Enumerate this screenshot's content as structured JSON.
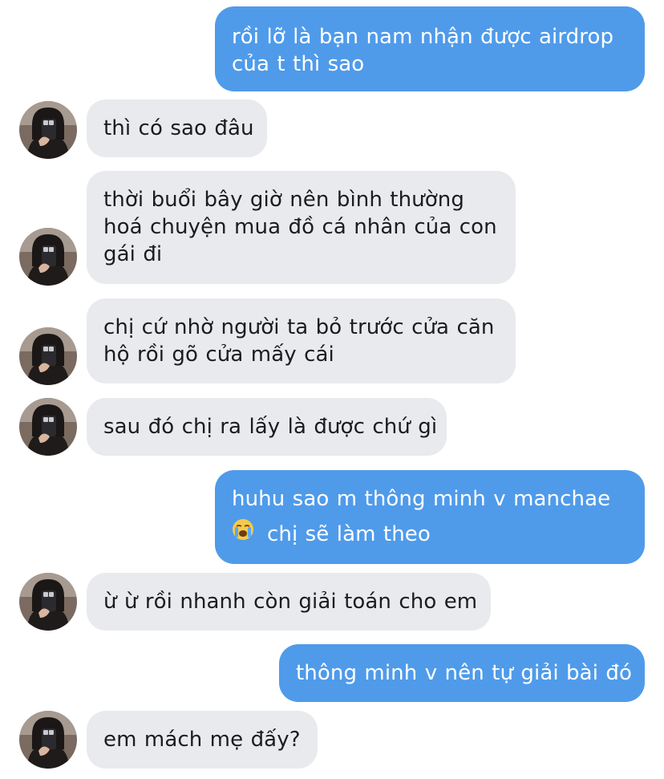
{
  "conversation": {
    "messages": [
      {
        "direction": "outgoing",
        "lines": [
          "rồi lỡ là bạn nam nhận được airdrop",
          "của t thì sao"
        ]
      },
      {
        "direction": "incoming",
        "lines": [
          "thì có sao đâu"
        ]
      },
      {
        "direction": "incoming",
        "lines": [
          "thời buổi bây giờ nên bình thường",
          "hoá chuyện mua đồ cá nhân của con",
          "gái đi"
        ]
      },
      {
        "direction": "incoming",
        "lines": [
          "chị cứ nhờ người ta bỏ trước cửa căn",
          "hộ rồi gõ cửa mấy cái"
        ]
      },
      {
        "direction": "incoming",
        "lines": [
          "sau đó chị ra lấy là được chứ gì"
        ]
      },
      {
        "direction": "outgoing",
        "lines": [
          "huhu sao m thông minh v manchae",
          "chị sẽ làm theo"
        ],
        "emoji": "loudly-crying-face-icon"
      },
      {
        "direction": "incoming",
        "lines": [
          "ừ ừ rồi nhanh còn giải toán cho em"
        ]
      },
      {
        "direction": "outgoing",
        "lines": [
          "thông minh v nên tự giải bài đó"
        ]
      },
      {
        "direction": "incoming",
        "lines": [
          "em mách mẹ đấy?"
        ]
      }
    ]
  },
  "colors": {
    "outgoing_bubble": "#4f9bea",
    "incoming_bubble": "#e8eaed",
    "incoming_text": "#1c1c1e",
    "outgoing_text": "#ffffff",
    "background": "#ffffff"
  }
}
